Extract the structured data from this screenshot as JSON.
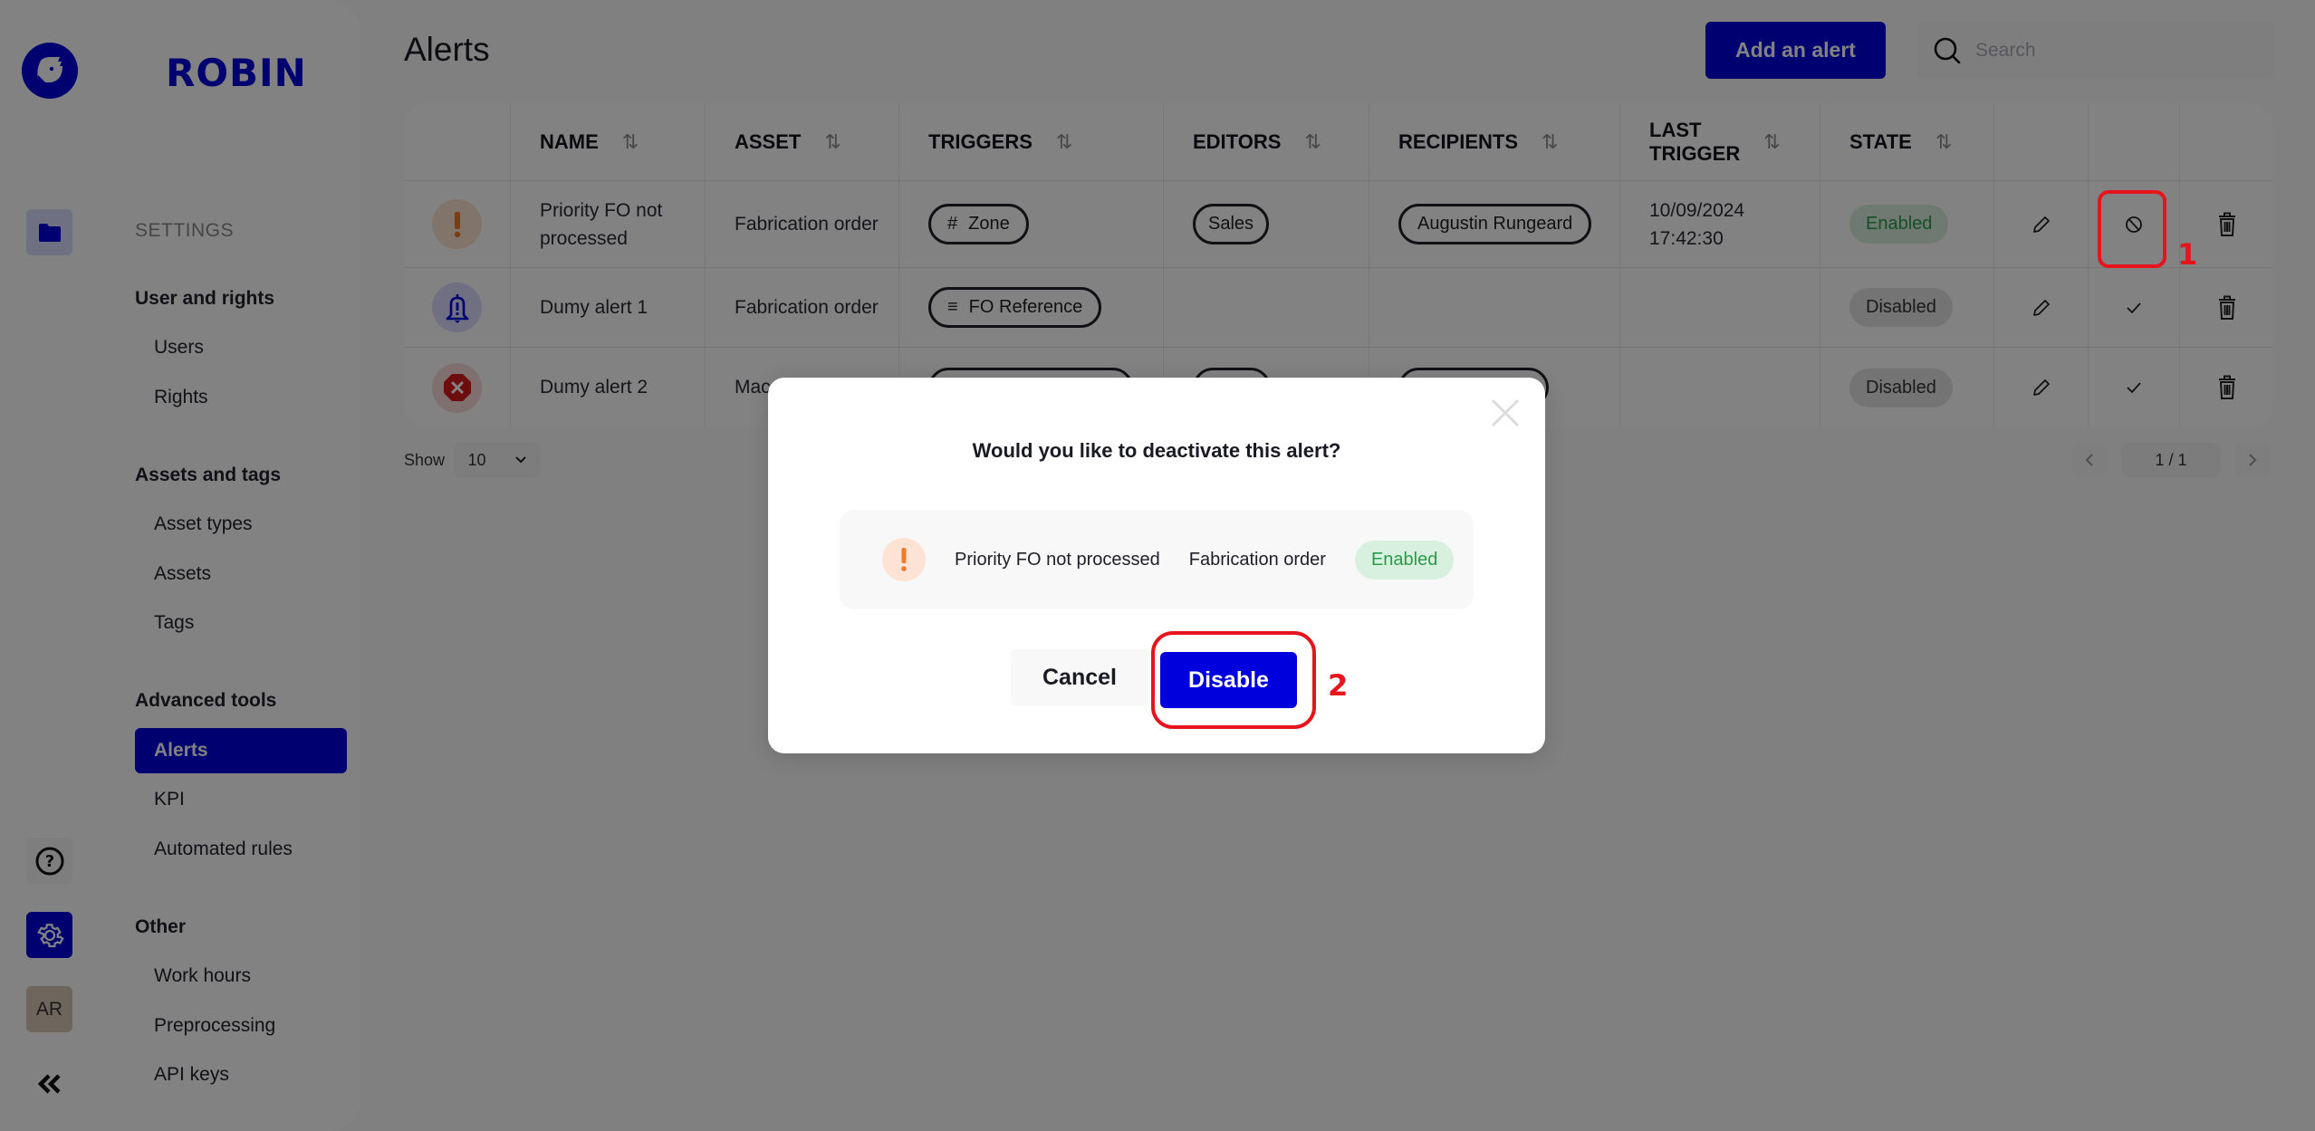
{
  "app": {
    "brand": "ROBIN"
  },
  "rail": {
    "icons": [
      "logo-icon",
      "folder-icon",
      "help-icon",
      "settings-icon",
      "avatar",
      "collapse-icon"
    ],
    "avatar_initials": "AR"
  },
  "sidebar": {
    "section_title": "SETTINGS",
    "groups": [
      {
        "label": "User and rights",
        "items": [
          {
            "label": "Users"
          },
          {
            "label": "Rights"
          }
        ]
      },
      {
        "label": "Assets and tags",
        "items": [
          {
            "label": "Asset types"
          },
          {
            "label": "Assets"
          },
          {
            "label": "Tags"
          }
        ]
      },
      {
        "label": "Advanced tools",
        "items": [
          {
            "label": "Alerts",
            "active": true
          },
          {
            "label": "KPI"
          },
          {
            "label": "Automated rules"
          }
        ]
      },
      {
        "label": "Other",
        "items": [
          {
            "label": "Work hours"
          },
          {
            "label": "Preprocessing"
          },
          {
            "label": "API keys"
          }
        ]
      }
    ]
  },
  "header": {
    "title": "Alerts",
    "add_button": "Add an alert",
    "search_placeholder": "Search"
  },
  "table": {
    "columns": [
      "NAME",
      "ASSET",
      "TRIGGERS",
      "EDITORS",
      "RECIPIENTS",
      "LAST TRIGGER",
      "STATE"
    ],
    "last_trigger_line1": "LAST",
    "last_trigger_line2": "TRIGGER",
    "sort_icon": "⇅",
    "rows": [
      {
        "icon": "warning-icon",
        "name_line1": "Priority FO not",
        "name_line2": "processed",
        "asset": "Fabrication order",
        "trigger": {
          "icon": "hash-icon",
          "glyph": "#",
          "label": "Zone"
        },
        "editor": "Sales",
        "recipient": "Augustin Rungeard",
        "last_trigger_date": "10/09/2024",
        "last_trigger_time": "17:42:30",
        "state": "Enabled",
        "toggle_icon": "disable-icon"
      },
      {
        "icon": "bell-icon",
        "name_line1": "Dumy alert 1",
        "name_line2": "",
        "asset": "Fabrication order",
        "trigger": {
          "icon": "text-icon",
          "glyph": "≡",
          "label": "FO Reference"
        },
        "editor": "",
        "recipient": "",
        "last_trigger_date": "",
        "last_trigger_time": "",
        "state": "Disabled",
        "toggle_icon": "check-icon"
      },
      {
        "icon": "error-icon",
        "name_line1": "Dumy alert 2",
        "name_line2": "",
        "asset": "Mac",
        "trigger": {
          "icon": "",
          "glyph": "",
          "label": ""
        },
        "editor": "",
        "recipient": "",
        "last_trigger_date": "",
        "last_trigger_time": "",
        "state": "Disabled",
        "toggle_icon": "check-icon"
      }
    ]
  },
  "pagination": {
    "show_label": "Show",
    "page_size": "10",
    "page_indicator": "1 / 1"
  },
  "annotations": {
    "step1": "1",
    "step2": "2"
  },
  "modal": {
    "title": "Would you like to deactivate this alert?",
    "alert_name": "Priority FO not processed",
    "alert_asset": "Fabrication order",
    "alert_state": "Enabled",
    "cancel_label": "Cancel",
    "confirm_label": "Disable"
  },
  "colors": {
    "brand": "#0000dd",
    "enabled_bg": "#d8f0de",
    "enabled_text": "#2c9a4c",
    "warning": "#f07a2c",
    "error": "#d61a1a",
    "annotation": "#e8141c"
  }
}
